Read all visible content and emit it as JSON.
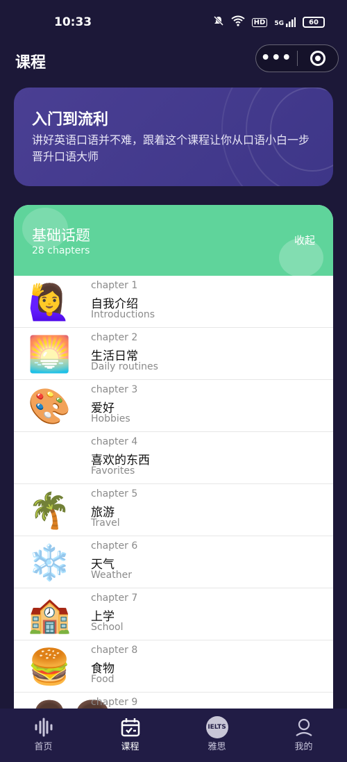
{
  "status_bar": {
    "time": "10:33",
    "signal_label": "5G",
    "hd_label": "HD",
    "battery": "60"
  },
  "nav": {
    "title": "课程"
  },
  "intro": {
    "title": "入门到流利",
    "description": "讲好英语口语并不难，跟着这个课程让你从口语小白一步晋升口语大师"
  },
  "topic": {
    "title": "基础话题",
    "subtitle": "28 chapters",
    "collapse_label": "收起"
  },
  "chapters": [
    {
      "num": "chapter 1",
      "zh": "自我介绍",
      "en": "Introductions",
      "icon": "🙋‍♀️"
    },
    {
      "num": "chapter 2",
      "zh": "生活日常",
      "en": "Daily routines",
      "icon": "🌅"
    },
    {
      "num": "chapter 3",
      "zh": "爱好",
      "en": "Hobbies",
      "icon": "🎨"
    },
    {
      "num": "chapter 4",
      "zh": "喜欢的东西",
      "en": "Favorites",
      "icon": "😍"
    },
    {
      "num": "chapter 5",
      "zh": "旅游",
      "en": "Travel",
      "icon": "🌴"
    },
    {
      "num": "chapter 6",
      "zh": "天气",
      "en": "Weather",
      "icon": "❄️"
    },
    {
      "num": "chapter 7",
      "zh": "上学",
      "en": "School",
      "icon": "🏫"
    },
    {
      "num": "chapter 8",
      "zh": "食物",
      "en": "Food",
      "icon": "🍔"
    },
    {
      "num": "chapter 9",
      "zh": "",
      "en": "",
      "icon": "👨‍👩"
    }
  ],
  "tabs": [
    {
      "label": "首页",
      "icon": "waveform-icon"
    },
    {
      "label": "课程",
      "icon": "calendar-check-icon"
    },
    {
      "label": "雅思",
      "icon": "ielts-icon",
      "badge": "IELTS"
    },
    {
      "label": "我的",
      "icon": "person-icon"
    }
  ]
}
